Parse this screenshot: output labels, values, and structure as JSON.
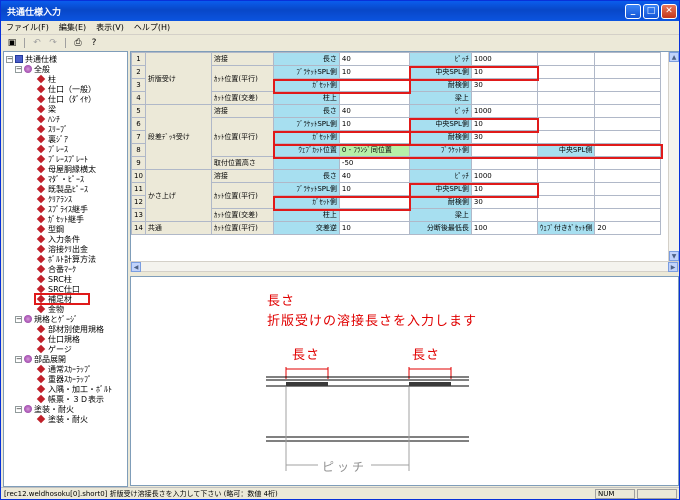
{
  "window": {
    "title": "共通仕様入力"
  },
  "menu": [
    "ファイル(F)",
    "編集(E)",
    "表示(V)",
    "ヘルプ(H)"
  ],
  "tree": {
    "root": "共通仕様",
    "nodes": [
      {
        "label": "全般",
        "level": 1,
        "type": "group"
      },
      {
        "label": "柱",
        "level": 2,
        "type": "item"
      },
      {
        "label": "仕口（一般）",
        "level": 2,
        "type": "item"
      },
      {
        "label": "仕口（ﾀﾞｲﾔ）",
        "level": 2,
        "type": "item"
      },
      {
        "label": "梁",
        "level": 2,
        "type": "item"
      },
      {
        "label": "ﾊﾝﾁ",
        "level": 2,
        "type": "item"
      },
      {
        "label": "ｽﾘｰﾌﾞ",
        "level": 2,
        "type": "item"
      },
      {
        "label": "裏ｼﾞｱ",
        "level": 2,
        "type": "item"
      },
      {
        "label": "ﾌﾞﾚｰｽ",
        "level": 2,
        "type": "item"
      },
      {
        "label": "ﾌﾞﾚｰｽﾌﾟﾚｰﾄ",
        "level": 2,
        "type": "item"
      },
      {
        "label": "母屋胴縁横太",
        "level": 2,
        "type": "item"
      },
      {
        "label": "ﾏﾀﾞ・ﾋﾟｰｽ",
        "level": 2,
        "type": "item"
      },
      {
        "label": "既製品ﾋﾟｰｽ",
        "level": 2,
        "type": "item"
      },
      {
        "label": "ｸﾘｱﾗﾝｽ",
        "level": 2,
        "type": "item"
      },
      {
        "label": "ｽﾌﾟﾗｲｽ継手",
        "level": 2,
        "type": "item"
      },
      {
        "label": "ｶﾞｾｯﾄ継手",
        "level": 2,
        "type": "item"
      },
      {
        "label": "型鋼",
        "level": 2,
        "type": "item"
      },
      {
        "label": "入力条件",
        "level": 2,
        "type": "item"
      },
      {
        "label": "溶接ｸﾘ出金",
        "level": 2,
        "type": "item"
      },
      {
        "label": "ﾎﾞﾙﾄ計算方法",
        "level": 2,
        "type": "item"
      },
      {
        "label": "合番ﾏｰｸ",
        "level": 2,
        "type": "item"
      },
      {
        "label": "SRC柱",
        "level": 2,
        "type": "item"
      },
      {
        "label": "SRC仕口",
        "level": 2,
        "type": "item"
      },
      {
        "label": "補足材",
        "level": 2,
        "type": "selected"
      },
      {
        "label": "金物",
        "level": 2,
        "type": "item"
      },
      {
        "label": "規格とｹﾞｰｼﾞ",
        "level": 1,
        "type": "group"
      },
      {
        "label": "部材別使用規格",
        "level": 2,
        "type": "item"
      },
      {
        "label": "仕口規格",
        "level": 2,
        "type": "item"
      },
      {
        "label": "ゲージ",
        "level": 2,
        "type": "item"
      },
      {
        "label": "部品展開",
        "level": 1,
        "type": "group"
      },
      {
        "label": "通常ｽｶｰﾗｯﾌﾟ",
        "level": 2,
        "type": "item"
      },
      {
        "label": "重器ｽｶｰﾗｯﾌﾟ",
        "level": 2,
        "type": "item"
      },
      {
        "label": "入隅・加工・ﾎﾞﾙﾄ",
        "level": 2,
        "type": "item"
      },
      {
        "label": "帳票・３Ｄ表示",
        "level": 2,
        "type": "item"
      },
      {
        "label": "塗装・耐火",
        "level": 1,
        "type": "group"
      },
      {
        "label": "塗装・耐火",
        "level": 2,
        "type": "item"
      }
    ]
  },
  "grid": {
    "rows": [
      {
        "n": "1",
        "cat": "折版受け",
        "sub": "溶接",
        "l1": "長さ",
        "v1": "40",
        "l2": "ﾋﾟｯﾁ",
        "v2": "1000"
      },
      {
        "n": "2",
        "cat": "",
        "sub": "ｶｯﾄ位置(平行)",
        "l1": "ﾌﾞﾗｹｯﾄSPL側",
        "v1": "10",
        "l2": "中央SPL側",
        "v2": "10"
      },
      {
        "n": "3",
        "cat": "",
        "sub": "",
        "l1": "ｶﾞｾｯﾄ側",
        "v1": "",
        "l2": "耐検側",
        "v2": "30"
      },
      {
        "n": "4",
        "cat": "",
        "sub": "ｶｯﾄ位置(交差)",
        "l1": "柱上",
        "v1": "",
        "l2": "梁上",
        "v2": ""
      },
      {
        "n": "5",
        "cat": "段差ﾃﾞｯｷ受け",
        "sub": "溶接",
        "l1": "長さ",
        "v1": "40",
        "l2": "ﾋﾟｯﾁ",
        "v2": "1000"
      },
      {
        "n": "6",
        "cat": "",
        "sub": "ｶｯﾄ位置(平行)",
        "l1": "ﾌﾞﾗｹｯﾄSPL側",
        "v1": "10",
        "l2": "中央SPL側",
        "v2": "10"
      },
      {
        "n": "7",
        "cat": "",
        "sub": "",
        "l1": "ｶﾞｾｯﾄ側",
        "v1": "",
        "l2": "耐検側",
        "v2": "30"
      },
      {
        "n": "8",
        "cat": "",
        "sub": "",
        "l1": "ｳｪﾌﾞｶｯﾄ位置",
        "v1": "0 - ﾌﾗﾝｼﾞ同位置",
        "l2": "ﾌﾞﾗｹｯﾄ側",
        "v2": "",
        "l3": "中央SPL側",
        "v3": ""
      },
      {
        "n": "9",
        "cat": "",
        "sub": "取付位置高さ",
        "l1": "",
        "v1": "-50",
        "l2": "",
        "v2": ""
      },
      {
        "n": "10",
        "cat": "かさ上げ",
        "sub": "溶接",
        "l1": "長さ",
        "v1": "40",
        "l2": "ﾋﾟｯﾁ",
        "v2": "1000"
      },
      {
        "n": "11",
        "cat": "",
        "sub": "ｶｯﾄ位置(平行)",
        "l1": "ﾌﾞﾗｹｯﾄSPL側",
        "v1": "10",
        "l2": "中央SPL側",
        "v2": "10"
      },
      {
        "n": "12",
        "cat": "",
        "sub": "",
        "l1": "ｶﾞｾｯﾄ側",
        "v1": "",
        "l2": "耐検側",
        "v2": "30"
      },
      {
        "n": "13",
        "cat": "",
        "sub": "ｶｯﾄ位置(交差)",
        "l1": "柱上",
        "v1": "",
        "l2": "梁上",
        "v2": ""
      },
      {
        "n": "14",
        "cat": "共通",
        "sub": "ｶｯﾄ位置(平行)",
        "l1": "交差逆",
        "v1": "10",
        "l2": "分断後最低長",
        "v2": "100",
        "l3": "ｳｪﾌﾞ付きｶﾞｾｯﾄ側",
        "v3": "20"
      }
    ]
  },
  "diagram": {
    "title1": "長さ",
    "title2": "折版受けの溶接長さを入力します",
    "len_label": "長さ",
    "pitch_label": "ピッチ"
  },
  "status": {
    "text": "[rec12.weldhosoku[0].short0] 折版受け溶接長さを入力して下さい (略可：数値 4桁)",
    "num": "NUM"
  }
}
